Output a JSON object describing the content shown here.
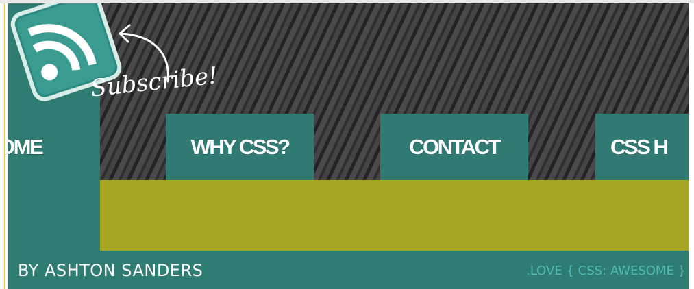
{
  "header": {
    "subscribe_label": "Subscribe!",
    "rss_icon": "rss-feed-icon"
  },
  "nav": {
    "items": [
      {
        "label": "OME"
      },
      {
        "label": "WHY CSS?"
      },
      {
        "label": "CONTACT"
      },
      {
        "label": "CSS H"
      }
    ]
  },
  "footer": {
    "byline": "BY ASHTON SANDERS",
    "tagline": ".LOVE { CSS: AWESOME }"
  },
  "colors": {
    "teal": "#2f7c73",
    "olive": "#a7a524",
    "stripe_dark": "#232325",
    "tagline": "#4fbcb3"
  }
}
